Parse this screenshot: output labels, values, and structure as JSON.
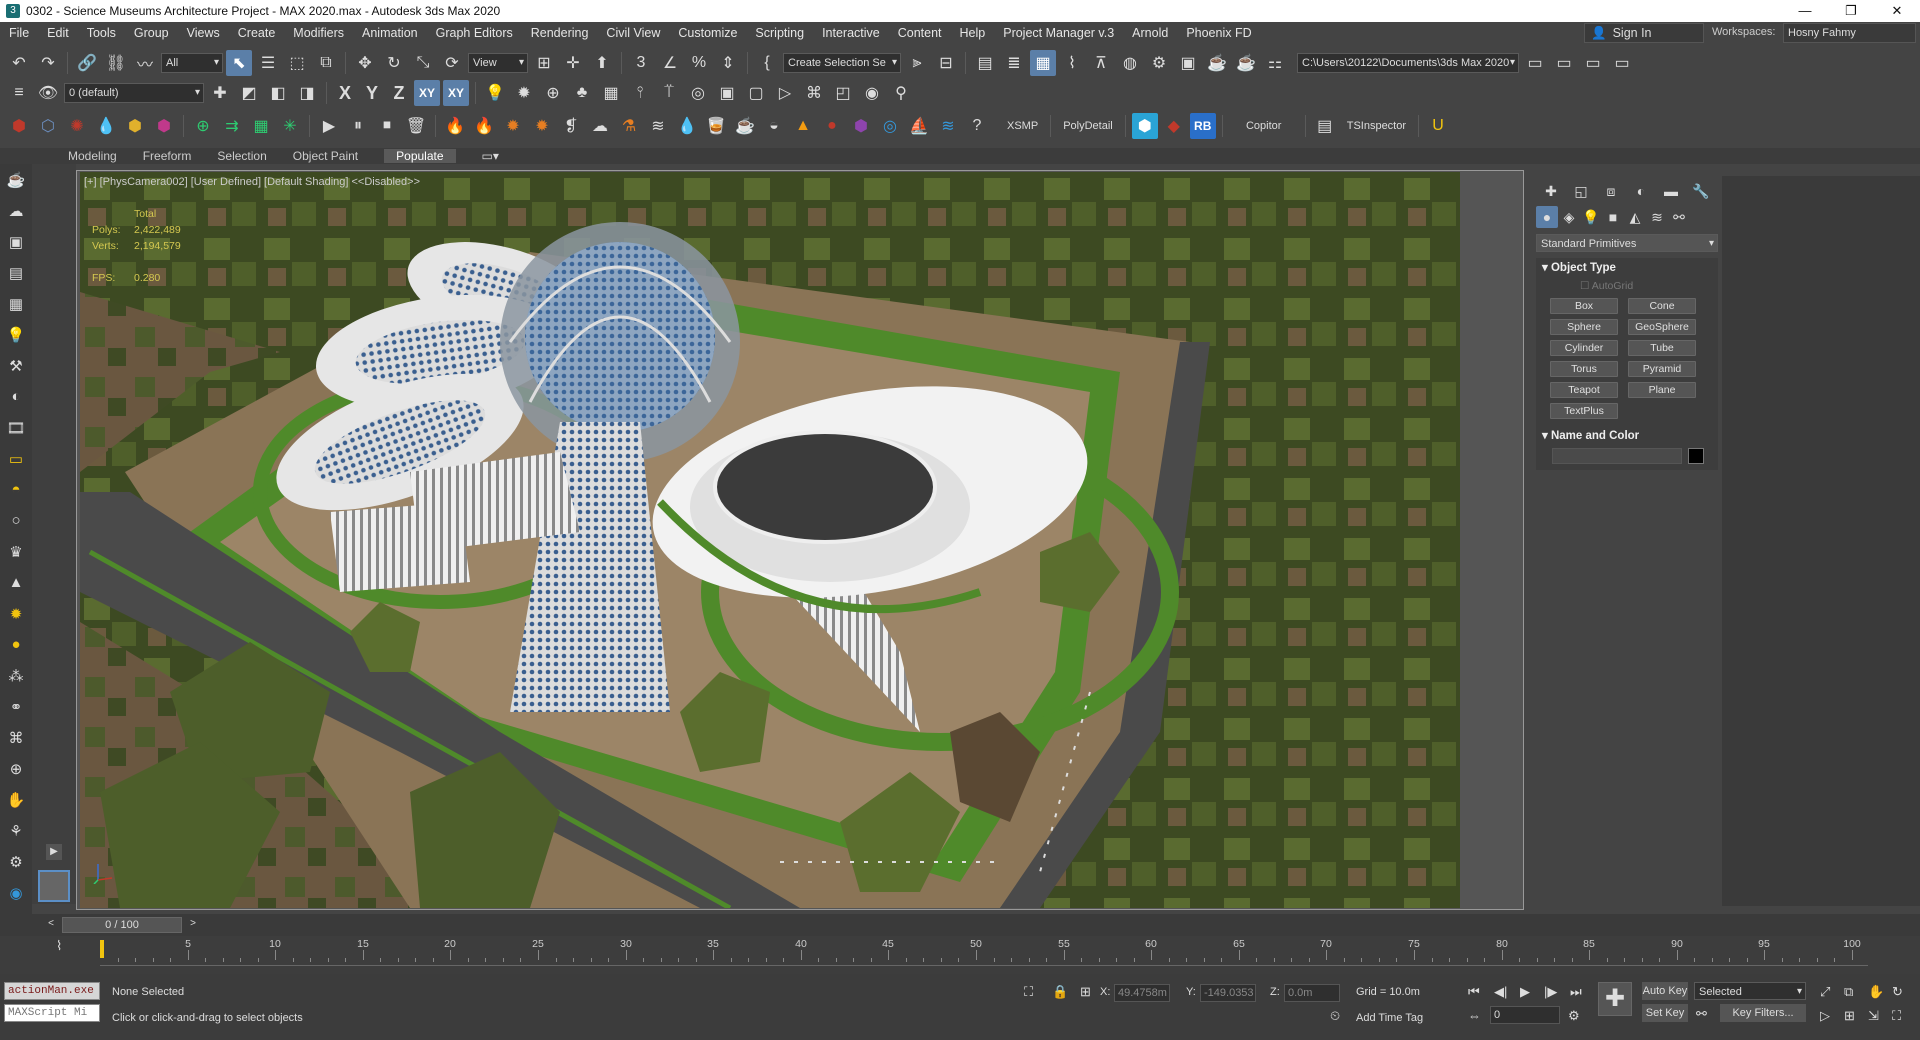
{
  "window": {
    "title": "0302 - Science Museums Architecture Project - MAX 2020.max - Autodesk 3ds Max 2020",
    "controls": [
      "—",
      "❐",
      "✕"
    ]
  },
  "menu": {
    "items": [
      "File",
      "Edit",
      "Tools",
      "Group",
      "Views",
      "Create",
      "Modifiers",
      "Animation",
      "Graph Editors",
      "Rendering",
      "Civil View",
      "Customize",
      "Scripting",
      "Interactive",
      "Content",
      "Help",
      "Project Manager v.3",
      "Arnold",
      "Phoenix FD"
    ],
    "sign_in": "Sign In",
    "workspaces_label": "Workspaces:",
    "workspace_value": "Hosny Fahmy"
  },
  "toolbar": {
    "selection_filter": "All",
    "ref_coord": "View",
    "named_selection": "Create Selection Se",
    "project_path": "C:\\Users\\20122\\Documents\\3ds Max 2020",
    "layer": "0 (default)",
    "axis_x": "X",
    "axis_y": "Y",
    "axis_z": "Z",
    "axis_xy": "XY",
    "axis_xy2": "XY",
    "xsmp": "XSMP",
    "polydetail": "PolyDetail",
    "rb": "RB",
    "copitor": "Copitor",
    "tsinspector": "TSInspector"
  },
  "ribbon": {
    "tabs": [
      "Modeling",
      "Freeform",
      "Selection",
      "Object Paint",
      "Populate"
    ],
    "active": "Populate"
  },
  "viewport": {
    "label": "[+] [PhysCamera002] [User Defined] [Default Shading]  <<Disabled>>",
    "stats": {
      "total_label": "Total",
      "polys_label": "Polys:",
      "polys_value": "2,422,489",
      "verts_label": "Verts:",
      "verts_value": "2,194,579",
      "fps_label": "FPS:",
      "fps_value": "0.280"
    },
    "colors": {
      "grass": "#4f8a2a",
      "trees": "#4d5e2a",
      "ground": "#8a7456",
      "road": "#4a4a4a",
      "building": "#e6e6e6"
    }
  },
  "command_panel": {
    "category": "Standard Primitives",
    "object_type_title": "Object Type",
    "autogrid": "AutoGrid",
    "buttons": [
      "Box",
      "Cone",
      "Sphere",
      "GeoSphere",
      "Cylinder",
      "Tube",
      "Torus",
      "Pyramid",
      "Teapot",
      "Plane",
      "TextPlus"
    ],
    "name_color_title": "Name and Color"
  },
  "timeline": {
    "frame": "0 / 100",
    "ticks": [
      "5",
      "10",
      "15",
      "20",
      "25",
      "30",
      "35",
      "40",
      "45",
      "50",
      "55",
      "60",
      "65",
      "70",
      "75",
      "80",
      "85",
      "90",
      "95",
      "100"
    ]
  },
  "status": {
    "script_listener1": "actionMan.exe",
    "script_listener2": "MAXScript Mi",
    "selection": "None Selected",
    "prompt": "Click or click-and-drag to select objects",
    "x_label": "X:",
    "x_value": "49.4758m",
    "y_label": "Y:",
    "y_value": "-149.0353",
    "z_label": "Z:",
    "z_value": "0.0m",
    "grid": "Grid = 10.0m",
    "add_time_tag": "Add Time Tag",
    "auto_key": "Auto Key",
    "set_key": "Set Key",
    "selected": "Selected",
    "key_filters": "Key Filters...",
    "frame_field": "0"
  }
}
